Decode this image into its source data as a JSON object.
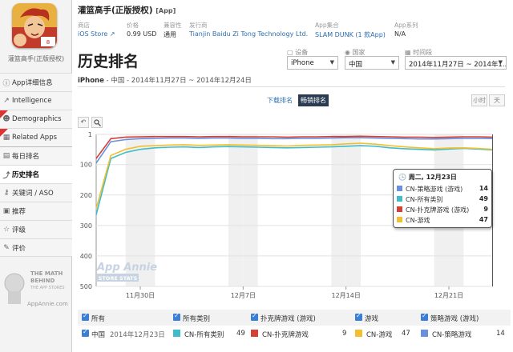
{
  "app": {
    "name": "灌篮高手(正版授权)",
    "tag": "[App]",
    "subtitle": "灌篮高手(正版授权)"
  },
  "meta": [
    {
      "label": "商店",
      "value": "iOS Store ↗"
    },
    {
      "label": "价格",
      "value": "0.99 USD"
    },
    {
      "label": "兼容性",
      "value": "通用"
    },
    {
      "label": "发行商",
      "value": "Tianjin Baidu Zi Tong Technology Ltd."
    },
    {
      "label": "App集合",
      "value": "SLAM DUNK (1 款App)"
    },
    {
      "label": "App系列",
      "value": "N/A"
    }
  ],
  "sidebar": {
    "items": [
      {
        "label": "App详细信息",
        "icon": "info-icon"
      },
      {
        "label": "Intelligence",
        "icon": "chart-icon"
      },
      {
        "label": "Demographics",
        "icon": "people-icon"
      },
      {
        "label": "Related Apps",
        "icon": "apps-icon"
      },
      {
        "label": "每日排名",
        "icon": "calendar-icon"
      },
      {
        "label": "历史排名",
        "icon": "history-icon"
      },
      {
        "label": "关键词 / ASO",
        "icon": "key-icon"
      },
      {
        "label": "推荐",
        "icon": "thumb-icon"
      },
      {
        "label": "评级",
        "icon": "star-icon"
      },
      {
        "label": "评价",
        "icon": "comment-icon"
      }
    ],
    "promo_line1": "THE MATH",
    "promo_line2": "BEHIND",
    "promo_line3": "THE APP STORES",
    "promo_site": "AppAnnie.com"
  },
  "page": {
    "title": "历史排名",
    "subtitle_device": "iPhone",
    "subtitle_rest": " - 中国 - 2014年11月27日 ~ 2014年12月24日"
  },
  "filters": {
    "device_label": "设备",
    "device_value": "iPhone",
    "country_label": "国家",
    "country_value": "中国",
    "period_label": "时间段",
    "period_value": "2014年11月27日 ~ 2014年1..."
  },
  "toggle": {
    "download": "下载排名",
    "grossing": "畅销排名"
  },
  "units": {
    "hour": "小时",
    "day": "天"
  },
  "tools": {
    "undo": "↶",
    "zoom": "🔍"
  },
  "watermark": {
    "line1": "App Annie",
    "line2": "STORE STATS"
  },
  "tooltip": {
    "date": "周二, 12月23日",
    "rows": [
      {
        "name": "CN-策略游戏 (游戏)",
        "value": "14",
        "color": "#6b8fe0"
      },
      {
        "name": "CN-所有类别",
        "value": "49",
        "color": "#40bcc8"
      },
      {
        "name": "CN-扑克牌游戏 (游戏)",
        "value": "9",
        "color": "#d44033"
      },
      {
        "name": "CN-游戏",
        "value": "47",
        "color": "#f0c030"
      }
    ]
  },
  "legend": {
    "header": {
      "all": "所有",
      "cat1": "所有类别",
      "cat2": "扑克牌游戏 (游戏)",
      "cat3": "游戏",
      "cat4": "策略游戏 (游戏)"
    },
    "row": {
      "country": "中国",
      "date": "2014年12月23日",
      "items": [
        {
          "name": "CN-所有类别",
          "value": "49",
          "color": "#40bcc8"
        },
        {
          "name": "CN-扑克牌游戏",
          "value": "9",
          "color": "#d44033"
        },
        {
          "name": "CN-游戏",
          "value": "47",
          "color": "#f0c030"
        },
        {
          "name": "CN-策略游戏",
          "value": "14",
          "color": "#6b8fe0"
        }
      ]
    }
  },
  "chart_data": {
    "type": "line",
    "ylim": [
      500,
      1
    ],
    "yticks": [
      1,
      100,
      200,
      300,
      400,
      500
    ],
    "x_start": "2014-11-27",
    "xtick_labels": [
      "11月30日",
      "12月7日",
      "12月14日",
      "12月21日"
    ],
    "xtick_days": [
      3,
      10,
      17,
      24
    ],
    "series": [
      {
        "name": "CN-所有类别",
        "color": "#40bcc8",
        "values": [
          265,
          80,
          60,
          50,
          45,
          43,
          42,
          44,
          42,
          41,
          42,
          43,
          44,
          45,
          44,
          43,
          42,
          40,
          38,
          40,
          45,
          48,
          50,
          52,
          49,
          47,
          49,
          52
        ]
      },
      {
        "name": "CN-游戏",
        "color": "#f0c030",
        "values": [
          245,
          70,
          50,
          40,
          38,
          36,
          35,
          37,
          36,
          35,
          36,
          37,
          38,
          39,
          37,
          36,
          35,
          32,
          30,
          33,
          38,
          42,
          45,
          48,
          46,
          45,
          47,
          50
        ]
      },
      {
        "name": "CN-策略游戏 (游戏)",
        "color": "#6b8fe0",
        "values": [
          95,
          25,
          18,
          15,
          14,
          13,
          13,
          14,
          13,
          13,
          14,
          14,
          15,
          15,
          14,
          14,
          13,
          12,
          12,
          13,
          14,
          15,
          16,
          16,
          15,
          14,
          14,
          15
        ]
      },
      {
        "name": "CN-扑克牌游戏 (游戏)",
        "color": "#d44033",
        "values": [
          80,
          15,
          10,
          9,
          8,
          8,
          8,
          9,
          8,
          8,
          9,
          9,
          9,
          10,
          9,
          9,
          8,
          8,
          7,
          8,
          9,
          10,
          10,
          11,
          10,
          9,
          9,
          10
        ]
      }
    ]
  }
}
